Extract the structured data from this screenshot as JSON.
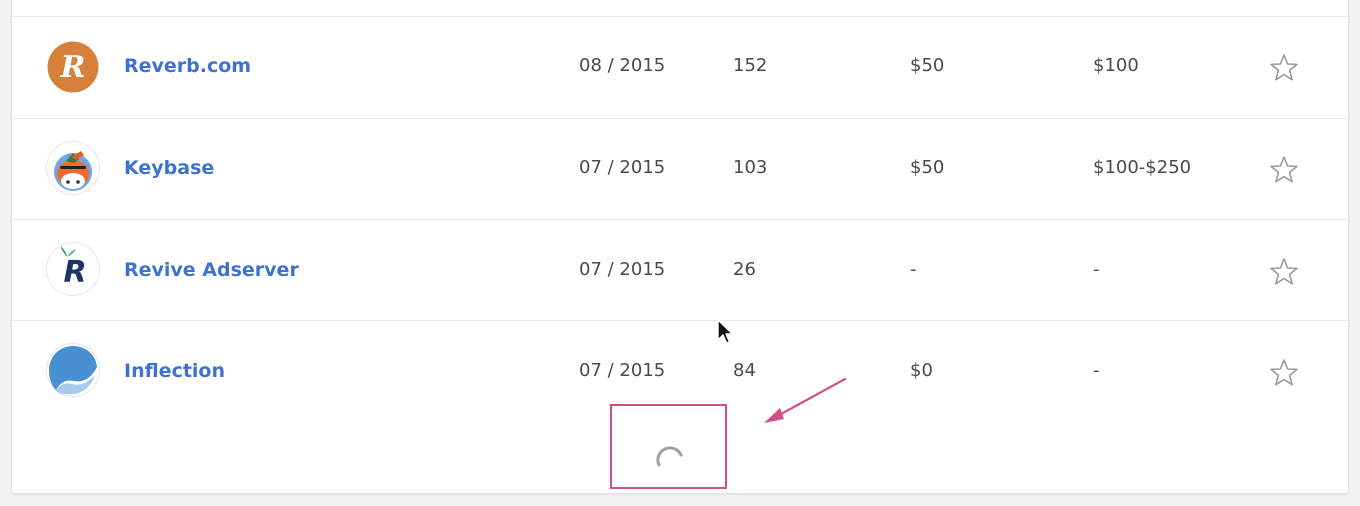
{
  "rows": [
    {
      "name": "Reverb.com",
      "logo_icon": "reverb-logo-icon",
      "logo_letter": "R",
      "date": "08 / 2015",
      "count": "152",
      "min_bounty": "$50",
      "avg_bounty": "$100"
    },
    {
      "name": "Keybase",
      "logo_icon": "keybase-logo-icon",
      "date": "07 / 2015",
      "count": "103",
      "min_bounty": "$50",
      "avg_bounty": "$100-$250"
    },
    {
      "name": "Revive Adserver",
      "logo_icon": "revive-adserver-logo-icon",
      "logo_letter": "R",
      "date": "07 / 2015",
      "count": "26",
      "min_bounty": "-",
      "avg_bounty": "-"
    },
    {
      "name": "Inflection",
      "logo_icon": "inflection-logo-icon",
      "date": "07 / 2015",
      "count": "84",
      "min_bounty": "$0",
      "avg_bounty": "-"
    }
  ],
  "loader": {
    "icon": "loading-spinner-icon"
  },
  "colors": {
    "link": "#3f72cf",
    "text": "#4a4a4a",
    "annotation": "#d24f85",
    "reverb_orange": "#d6803a",
    "inflection_blue": "#4b8fd3",
    "revive_navy": "#1f3466"
  }
}
